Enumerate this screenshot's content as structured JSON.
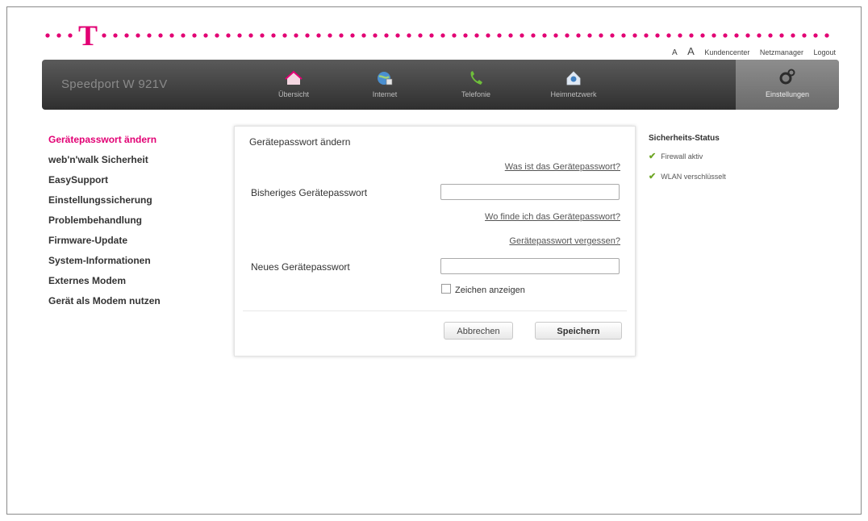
{
  "brand": {
    "logo_letter": "T",
    "accent_color": "#e20074"
  },
  "toplinks": {
    "font_small": "A",
    "font_large": "A",
    "kundencenter": "Kundencenter",
    "netzmanager": "Netzmanager",
    "logout": "Logout"
  },
  "navbar": {
    "product_name": "Speedport W 921V",
    "items": [
      {
        "label": "Übersicht",
        "icon": "home-icon"
      },
      {
        "label": "Internet",
        "icon": "globe-icon"
      },
      {
        "label": "Telefonie",
        "icon": "phone-icon"
      },
      {
        "label": "Heimnetzwerk",
        "icon": "home-network-icon"
      }
    ],
    "settings_label": "Einstellungen"
  },
  "sidebar": {
    "items": [
      {
        "label": "Gerätepasswort ändern",
        "active": true
      },
      {
        "label": "web'n'walk Sicherheit"
      },
      {
        "label": "EasySupport"
      },
      {
        "label": "Einstellungssicherung"
      },
      {
        "label": "Problembehandlung"
      },
      {
        "label": "Firmware-Update"
      },
      {
        "label": "System-Informationen"
      },
      {
        "label": "Externes Modem"
      },
      {
        "label": "Gerät als Modem nutzen"
      }
    ]
  },
  "panel": {
    "title": "Gerätepasswort ändern",
    "help_link": "Was ist das Gerätepasswort?",
    "current_label": "Bisheriges Gerätepasswort",
    "current_value": "",
    "find_link": "Wo finde ich das Gerätepasswort?",
    "forgot_link": "Gerätepasswort vergessen?",
    "new_label": "Neues Gerätepasswort",
    "new_value": "",
    "show_chars_label": "Zeichen anzeigen",
    "cancel_label": "Abbrechen",
    "save_label": "Speichern"
  },
  "status": {
    "title": "Sicherheits-Status",
    "items": [
      {
        "label": "Firewall aktiv"
      },
      {
        "label": "WLAN verschlüsselt"
      }
    ]
  }
}
